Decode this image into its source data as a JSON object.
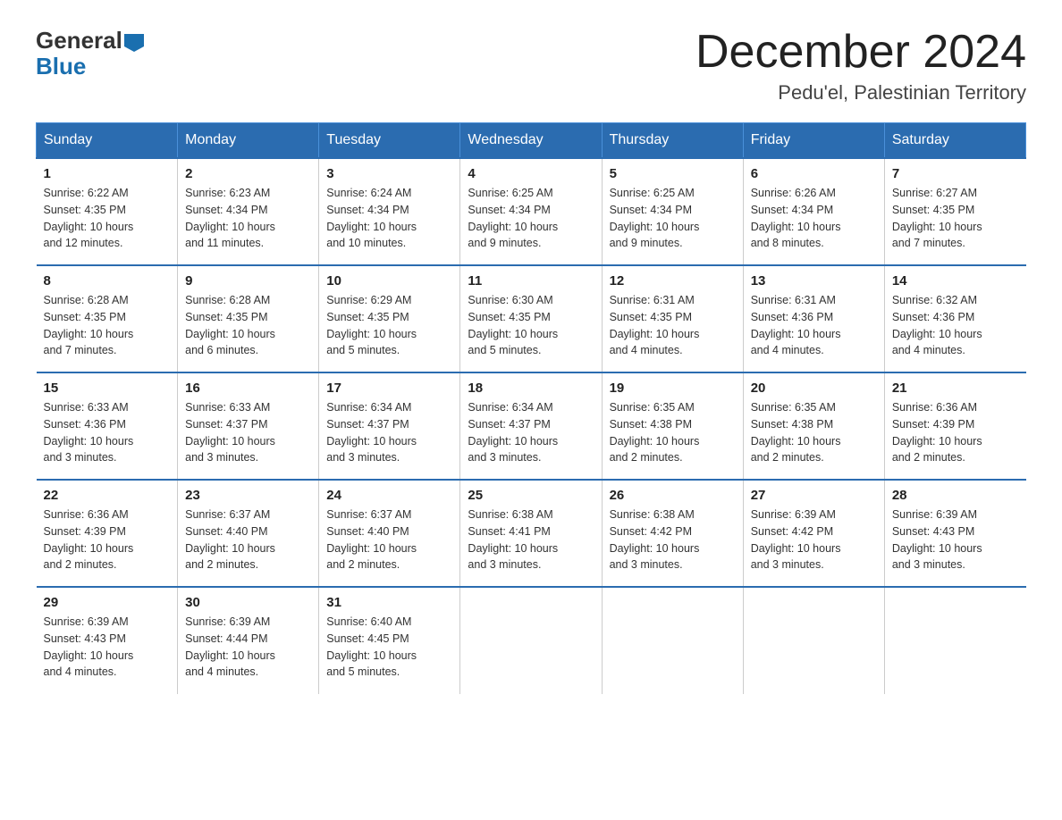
{
  "header": {
    "logo": {
      "part1": "General",
      "part2": "Blue"
    },
    "title": "December 2024",
    "location": "Pedu'el, Palestinian Territory"
  },
  "weekdays": [
    "Sunday",
    "Monday",
    "Tuesday",
    "Wednesday",
    "Thursday",
    "Friday",
    "Saturday"
  ],
  "weeks": [
    [
      {
        "day": "1",
        "sunrise": "6:22 AM",
        "sunset": "4:35 PM",
        "daylight": "10 hours and 12 minutes."
      },
      {
        "day": "2",
        "sunrise": "6:23 AM",
        "sunset": "4:34 PM",
        "daylight": "10 hours and 11 minutes."
      },
      {
        "day": "3",
        "sunrise": "6:24 AM",
        "sunset": "4:34 PM",
        "daylight": "10 hours and 10 minutes."
      },
      {
        "day": "4",
        "sunrise": "6:25 AM",
        "sunset": "4:34 PM",
        "daylight": "10 hours and 9 minutes."
      },
      {
        "day": "5",
        "sunrise": "6:25 AM",
        "sunset": "4:34 PM",
        "daylight": "10 hours and 9 minutes."
      },
      {
        "day": "6",
        "sunrise": "6:26 AM",
        "sunset": "4:34 PM",
        "daylight": "10 hours and 8 minutes."
      },
      {
        "day": "7",
        "sunrise": "6:27 AM",
        "sunset": "4:35 PM",
        "daylight": "10 hours and 7 minutes."
      }
    ],
    [
      {
        "day": "8",
        "sunrise": "6:28 AM",
        "sunset": "4:35 PM",
        "daylight": "10 hours and 7 minutes."
      },
      {
        "day": "9",
        "sunrise": "6:28 AM",
        "sunset": "4:35 PM",
        "daylight": "10 hours and 6 minutes."
      },
      {
        "day": "10",
        "sunrise": "6:29 AM",
        "sunset": "4:35 PM",
        "daylight": "10 hours and 5 minutes."
      },
      {
        "day": "11",
        "sunrise": "6:30 AM",
        "sunset": "4:35 PM",
        "daylight": "10 hours and 5 minutes."
      },
      {
        "day": "12",
        "sunrise": "6:31 AM",
        "sunset": "4:35 PM",
        "daylight": "10 hours and 4 minutes."
      },
      {
        "day": "13",
        "sunrise": "6:31 AM",
        "sunset": "4:36 PM",
        "daylight": "10 hours and 4 minutes."
      },
      {
        "day": "14",
        "sunrise": "6:32 AM",
        "sunset": "4:36 PM",
        "daylight": "10 hours and 4 minutes."
      }
    ],
    [
      {
        "day": "15",
        "sunrise": "6:33 AM",
        "sunset": "4:36 PM",
        "daylight": "10 hours and 3 minutes."
      },
      {
        "day": "16",
        "sunrise": "6:33 AM",
        "sunset": "4:37 PM",
        "daylight": "10 hours and 3 minutes."
      },
      {
        "day": "17",
        "sunrise": "6:34 AM",
        "sunset": "4:37 PM",
        "daylight": "10 hours and 3 minutes."
      },
      {
        "day": "18",
        "sunrise": "6:34 AM",
        "sunset": "4:37 PM",
        "daylight": "10 hours and 3 minutes."
      },
      {
        "day": "19",
        "sunrise": "6:35 AM",
        "sunset": "4:38 PM",
        "daylight": "10 hours and 2 minutes."
      },
      {
        "day": "20",
        "sunrise": "6:35 AM",
        "sunset": "4:38 PM",
        "daylight": "10 hours and 2 minutes."
      },
      {
        "day": "21",
        "sunrise": "6:36 AM",
        "sunset": "4:39 PM",
        "daylight": "10 hours and 2 minutes."
      }
    ],
    [
      {
        "day": "22",
        "sunrise": "6:36 AM",
        "sunset": "4:39 PM",
        "daylight": "10 hours and 2 minutes."
      },
      {
        "day": "23",
        "sunrise": "6:37 AM",
        "sunset": "4:40 PM",
        "daylight": "10 hours and 2 minutes."
      },
      {
        "day": "24",
        "sunrise": "6:37 AM",
        "sunset": "4:40 PM",
        "daylight": "10 hours and 2 minutes."
      },
      {
        "day": "25",
        "sunrise": "6:38 AM",
        "sunset": "4:41 PM",
        "daylight": "10 hours and 3 minutes."
      },
      {
        "day": "26",
        "sunrise": "6:38 AM",
        "sunset": "4:42 PM",
        "daylight": "10 hours and 3 minutes."
      },
      {
        "day": "27",
        "sunrise": "6:39 AM",
        "sunset": "4:42 PM",
        "daylight": "10 hours and 3 minutes."
      },
      {
        "day": "28",
        "sunrise": "6:39 AM",
        "sunset": "4:43 PM",
        "daylight": "10 hours and 3 minutes."
      }
    ],
    [
      {
        "day": "29",
        "sunrise": "6:39 AM",
        "sunset": "4:43 PM",
        "daylight": "10 hours and 4 minutes."
      },
      {
        "day": "30",
        "sunrise": "6:39 AM",
        "sunset": "4:44 PM",
        "daylight": "10 hours and 4 minutes."
      },
      {
        "day": "31",
        "sunrise": "6:40 AM",
        "sunset": "4:45 PM",
        "daylight": "10 hours and 5 minutes."
      },
      null,
      null,
      null,
      null
    ]
  ],
  "labels": {
    "sunrise": "Sunrise:",
    "sunset": "Sunset:",
    "daylight": "Daylight:"
  }
}
